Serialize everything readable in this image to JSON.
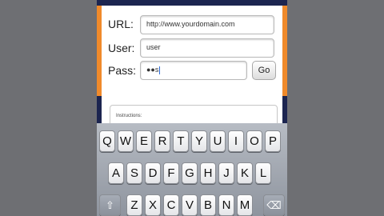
{
  "form": {
    "url_label": "URL:",
    "url_value": "http://www.yourdomain.com",
    "user_label": "User:",
    "user_value": "user",
    "pass_label": "Pass:",
    "pass_value": "●●s",
    "go_label": "Go",
    "instructions_label": "Instructions:"
  },
  "keyboard": {
    "row1": [
      "Q",
      "W",
      "E",
      "R",
      "T",
      "Y",
      "U",
      "I",
      "O",
      "P"
    ],
    "row2": [
      "A",
      "S",
      "D",
      "F",
      "G",
      "H",
      "J",
      "K",
      "L"
    ],
    "row3": [
      "Z",
      "X",
      "C",
      "V",
      "B",
      "N",
      "M"
    ],
    "shift_icon": "⇧",
    "delete_icon": "⌫"
  },
  "colors": {
    "accent_orange": "#f08a2b",
    "navy": "#1c2550",
    "background": "#6e6f73"
  }
}
